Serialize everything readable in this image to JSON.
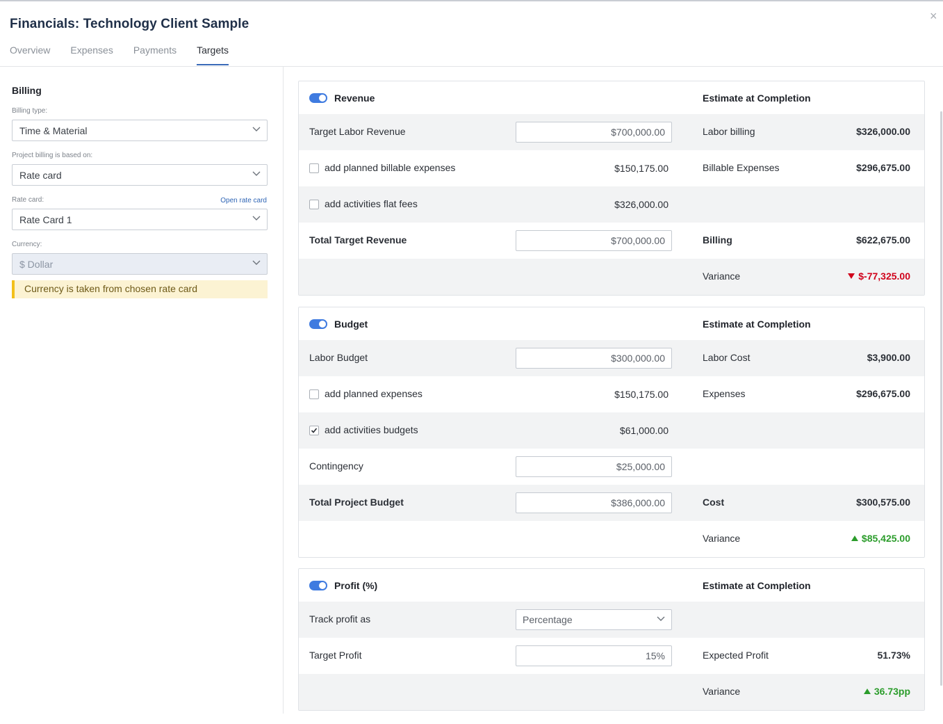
{
  "header": {
    "title": "Financials: Technology Client Sample",
    "close_glyph": "×",
    "tabs": [
      "Overview",
      "Expenses",
      "Payments",
      "Targets"
    ],
    "active_tab": "Targets"
  },
  "billing": {
    "heading": "Billing",
    "billing_type_label": "Billing type:",
    "billing_type_value": "Time & Material",
    "based_on_label": "Project billing is based on:",
    "based_on_value": "Rate card",
    "rate_card_label": "Rate card:",
    "open_rate_card": "Open rate card",
    "rate_card_value": "Rate Card 1",
    "currency_label": "Currency:",
    "currency_value": "$ Dollar",
    "currency_notice": "Currency is taken from chosen rate card"
  },
  "revenue": {
    "title": "Revenue",
    "eac": "Estimate at Completion",
    "enabled": true,
    "target_labor_label": "Target Labor Revenue",
    "target_labor_value": "$700,000.00",
    "labor_billing_label": "Labor billing",
    "labor_billing_value": "$326,000.00",
    "planned_expenses_label": "add planned billable expenses",
    "planned_expenses_checked": false,
    "planned_expenses_value": "$150,175.00",
    "billable_expenses_label": "Billable Expenses",
    "billable_expenses_value": "$296,675.00",
    "flat_fees_label": "add activities flat fees",
    "flat_fees_checked": false,
    "flat_fees_value": "$326,000.00",
    "total_label": "Total Target Revenue",
    "total_value": "$700,000.00",
    "billing_label": "Billing",
    "billing_value": "$622,675.00",
    "variance_label": "Variance",
    "variance_value": "$-77,325.00"
  },
  "budget": {
    "title": "Budget",
    "eac": "Estimate at Completion",
    "enabled": true,
    "labor_budget_label": "Labor Budget",
    "labor_budget_value": "$300,000.00",
    "labor_cost_label": "Labor Cost",
    "labor_cost_value": "$3,900.00",
    "planned_expenses_label": "add planned expenses",
    "planned_expenses_checked": false,
    "planned_expenses_value": "$150,175.00",
    "expenses_label": "Expenses",
    "expenses_value": "$296,675.00",
    "activities_budgets_label": "add activities budgets",
    "activities_budgets_checked": true,
    "activities_budgets_value": "$61,000.00",
    "contingency_label": "Contingency",
    "contingency_value": "$25,000.00",
    "total_label": "Total Project Budget",
    "total_value": "$386,000.00",
    "cost_label": "Cost",
    "cost_value": "$300,575.00",
    "variance_label": "Variance",
    "variance_value": "$85,425.00"
  },
  "profit": {
    "title": "Profit (%)",
    "eac": "Estimate at Completion",
    "enabled": true,
    "track_label": "Track profit as",
    "track_value": "Percentage",
    "target_label": "Target Profit",
    "target_value": "15%",
    "expected_label": "Expected Profit",
    "expected_value": "51.73%",
    "variance_label": "Variance",
    "variance_value": "36.73pp"
  },
  "colors": {
    "accent": "#3f7be0",
    "negative": "#d0021b",
    "positive": "#2b9c2b",
    "notice_bg": "#fcf3d3",
    "notice_bar": "#f2c01b"
  }
}
